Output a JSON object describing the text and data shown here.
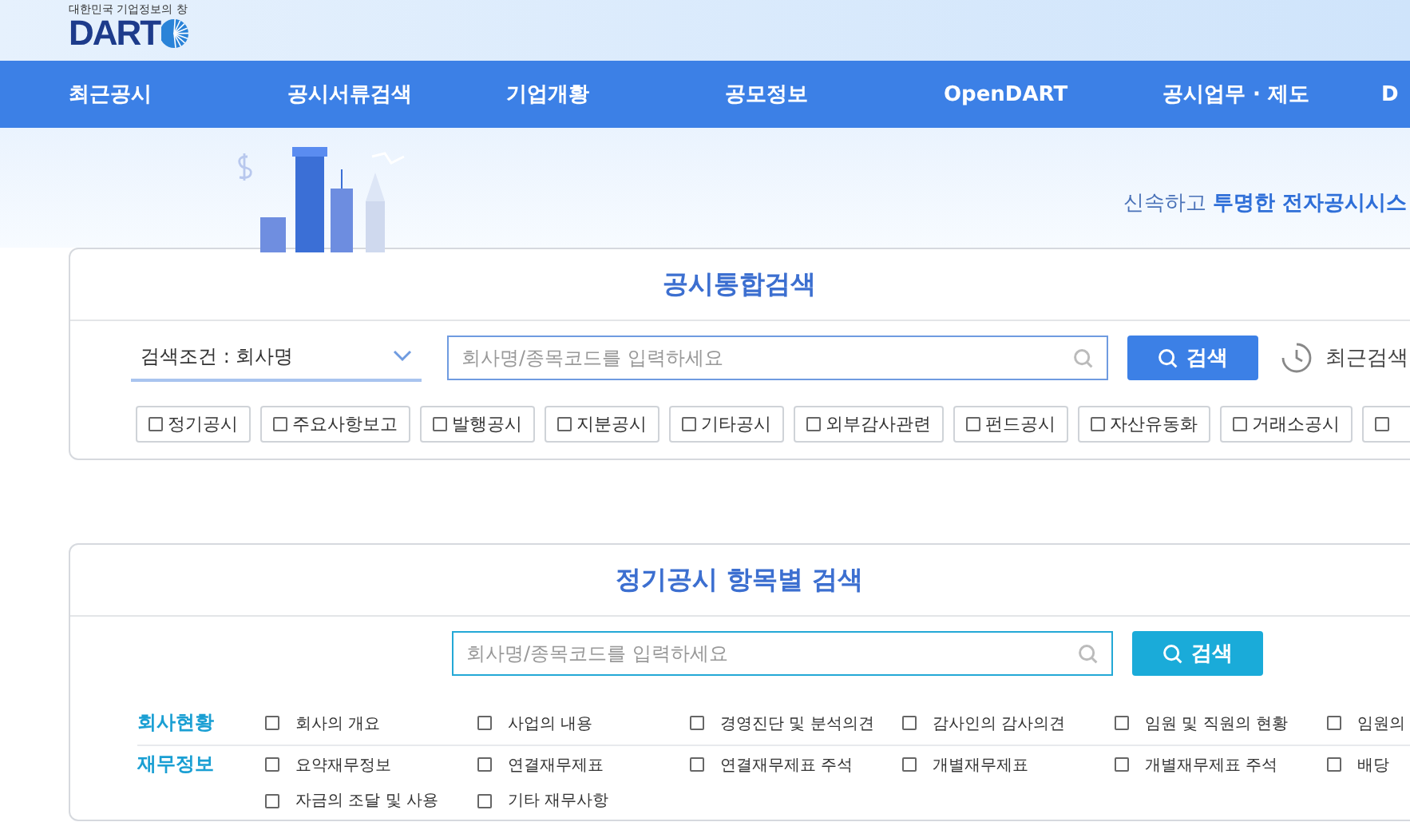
{
  "header": {
    "logo_tagline": "대한민국 기업정보의 창",
    "logo_text": "DART"
  },
  "nav": [
    "최근공시",
    "공시서류검색",
    "기업개황",
    "공모정보",
    "OpenDART",
    "공시업무 · 제도",
    "D"
  ],
  "hero": {
    "slogan_light": "신속하고",
    "slogan_bold": "투명한 전자공시시스"
  },
  "integrated_search": {
    "title": "공시통합검색",
    "condition": "검색조건 : 회사명",
    "placeholder": "회사명/종목코드를 입력하세요",
    "button": "검색",
    "recent": "최근검색",
    "filters": [
      {
        "label": "정기공시",
        "checked": false
      },
      {
        "label": "주요사항보고",
        "checked": false
      },
      {
        "label": "발행공시",
        "checked": false
      },
      {
        "label": "지분공시",
        "checked": false
      },
      {
        "label": "기타공시",
        "checked": false
      },
      {
        "label": "외부감사관련",
        "checked": false
      },
      {
        "label": "펀드공시",
        "checked": false
      },
      {
        "label": "자산유동화",
        "checked": false
      },
      {
        "label": "거래소공시",
        "checked": false
      },
      {
        "checked": false
      }
    ]
  },
  "item_search": {
    "title": "정기공시 항목별 검색",
    "placeholder": "회사명/종목코드를 입력하세요",
    "button": "검색",
    "groups": [
      {
        "name": "회사현황",
        "items": [
          {
            "label": "회사의 개요",
            "checked": false
          },
          {
            "label": "사업의 내용",
            "checked": false
          },
          {
            "label": "경영진단 및 분석의견",
            "checked": false
          },
          {
            "label": "감사인의 감사의견",
            "checked": false
          },
          {
            "label": "임원 및 직원의 현황",
            "checked": false
          },
          {
            "label": "임원의",
            "checked": false
          }
        ]
      },
      {
        "name": "재무정보",
        "items": [
          {
            "label": "요약재무정보",
            "checked": false
          },
          {
            "label": "연결재무제표",
            "checked": false
          },
          {
            "label": "연결재무제표 주석",
            "checked": false
          },
          {
            "label": "개별재무제표",
            "checked": false
          },
          {
            "label": "개별재무제표 주석",
            "checked": false
          },
          {
            "label": "배당",
            "checked": false
          },
          {
            "label": "자금의 조달 및 사용",
            "checked": false
          },
          {
            "label": "기타 재무사항",
            "checked": false
          }
        ]
      }
    ]
  }
}
